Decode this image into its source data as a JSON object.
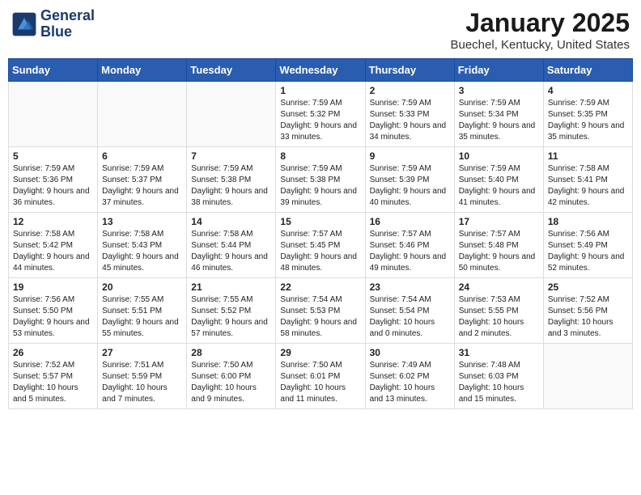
{
  "logo": {
    "line1": "General",
    "line2": "Blue"
  },
  "title": "January 2025",
  "location": "Buechel, Kentucky, United States",
  "days_of_week": [
    "Sunday",
    "Monday",
    "Tuesday",
    "Wednesday",
    "Thursday",
    "Friday",
    "Saturday"
  ],
  "weeks": [
    [
      {
        "day": "",
        "sunrise": "",
        "sunset": "",
        "daylight": ""
      },
      {
        "day": "",
        "sunrise": "",
        "sunset": "",
        "daylight": ""
      },
      {
        "day": "",
        "sunrise": "",
        "sunset": "",
        "daylight": ""
      },
      {
        "day": "1",
        "sunrise": "Sunrise: 7:59 AM",
        "sunset": "Sunset: 5:32 PM",
        "daylight": "Daylight: 9 hours and 33 minutes."
      },
      {
        "day": "2",
        "sunrise": "Sunrise: 7:59 AM",
        "sunset": "Sunset: 5:33 PM",
        "daylight": "Daylight: 9 hours and 34 minutes."
      },
      {
        "day": "3",
        "sunrise": "Sunrise: 7:59 AM",
        "sunset": "Sunset: 5:34 PM",
        "daylight": "Daylight: 9 hours and 35 minutes."
      },
      {
        "day": "4",
        "sunrise": "Sunrise: 7:59 AM",
        "sunset": "Sunset: 5:35 PM",
        "daylight": "Daylight: 9 hours and 35 minutes."
      }
    ],
    [
      {
        "day": "5",
        "sunrise": "Sunrise: 7:59 AM",
        "sunset": "Sunset: 5:36 PM",
        "daylight": "Daylight: 9 hours and 36 minutes."
      },
      {
        "day": "6",
        "sunrise": "Sunrise: 7:59 AM",
        "sunset": "Sunset: 5:37 PM",
        "daylight": "Daylight: 9 hours and 37 minutes."
      },
      {
        "day": "7",
        "sunrise": "Sunrise: 7:59 AM",
        "sunset": "Sunset: 5:38 PM",
        "daylight": "Daylight: 9 hours and 38 minutes."
      },
      {
        "day": "8",
        "sunrise": "Sunrise: 7:59 AM",
        "sunset": "Sunset: 5:38 PM",
        "daylight": "Daylight: 9 hours and 39 minutes."
      },
      {
        "day": "9",
        "sunrise": "Sunrise: 7:59 AM",
        "sunset": "Sunset: 5:39 PM",
        "daylight": "Daylight: 9 hours and 40 minutes."
      },
      {
        "day": "10",
        "sunrise": "Sunrise: 7:59 AM",
        "sunset": "Sunset: 5:40 PM",
        "daylight": "Daylight: 9 hours and 41 minutes."
      },
      {
        "day": "11",
        "sunrise": "Sunrise: 7:58 AM",
        "sunset": "Sunset: 5:41 PM",
        "daylight": "Daylight: 9 hours and 42 minutes."
      }
    ],
    [
      {
        "day": "12",
        "sunrise": "Sunrise: 7:58 AM",
        "sunset": "Sunset: 5:42 PM",
        "daylight": "Daylight: 9 hours and 44 minutes."
      },
      {
        "day": "13",
        "sunrise": "Sunrise: 7:58 AM",
        "sunset": "Sunset: 5:43 PM",
        "daylight": "Daylight: 9 hours and 45 minutes."
      },
      {
        "day": "14",
        "sunrise": "Sunrise: 7:58 AM",
        "sunset": "Sunset: 5:44 PM",
        "daylight": "Daylight: 9 hours and 46 minutes."
      },
      {
        "day": "15",
        "sunrise": "Sunrise: 7:57 AM",
        "sunset": "Sunset: 5:45 PM",
        "daylight": "Daylight: 9 hours and 48 minutes."
      },
      {
        "day": "16",
        "sunrise": "Sunrise: 7:57 AM",
        "sunset": "Sunset: 5:46 PM",
        "daylight": "Daylight: 9 hours and 49 minutes."
      },
      {
        "day": "17",
        "sunrise": "Sunrise: 7:57 AM",
        "sunset": "Sunset: 5:48 PM",
        "daylight": "Daylight: 9 hours and 50 minutes."
      },
      {
        "day": "18",
        "sunrise": "Sunrise: 7:56 AM",
        "sunset": "Sunset: 5:49 PM",
        "daylight": "Daylight: 9 hours and 52 minutes."
      }
    ],
    [
      {
        "day": "19",
        "sunrise": "Sunrise: 7:56 AM",
        "sunset": "Sunset: 5:50 PM",
        "daylight": "Daylight: 9 hours and 53 minutes."
      },
      {
        "day": "20",
        "sunrise": "Sunrise: 7:55 AM",
        "sunset": "Sunset: 5:51 PM",
        "daylight": "Daylight: 9 hours and 55 minutes."
      },
      {
        "day": "21",
        "sunrise": "Sunrise: 7:55 AM",
        "sunset": "Sunset: 5:52 PM",
        "daylight": "Daylight: 9 hours and 57 minutes."
      },
      {
        "day": "22",
        "sunrise": "Sunrise: 7:54 AM",
        "sunset": "Sunset: 5:53 PM",
        "daylight": "Daylight: 9 hours and 58 minutes."
      },
      {
        "day": "23",
        "sunrise": "Sunrise: 7:54 AM",
        "sunset": "Sunset: 5:54 PM",
        "daylight": "Daylight: 10 hours and 0 minutes."
      },
      {
        "day": "24",
        "sunrise": "Sunrise: 7:53 AM",
        "sunset": "Sunset: 5:55 PM",
        "daylight": "Daylight: 10 hours and 2 minutes."
      },
      {
        "day": "25",
        "sunrise": "Sunrise: 7:52 AM",
        "sunset": "Sunset: 5:56 PM",
        "daylight": "Daylight: 10 hours and 3 minutes."
      }
    ],
    [
      {
        "day": "26",
        "sunrise": "Sunrise: 7:52 AM",
        "sunset": "Sunset: 5:57 PM",
        "daylight": "Daylight: 10 hours and 5 minutes."
      },
      {
        "day": "27",
        "sunrise": "Sunrise: 7:51 AM",
        "sunset": "Sunset: 5:59 PM",
        "daylight": "Daylight: 10 hours and 7 minutes."
      },
      {
        "day": "28",
        "sunrise": "Sunrise: 7:50 AM",
        "sunset": "Sunset: 6:00 PM",
        "daylight": "Daylight: 10 hours and 9 minutes."
      },
      {
        "day": "29",
        "sunrise": "Sunrise: 7:50 AM",
        "sunset": "Sunset: 6:01 PM",
        "daylight": "Daylight: 10 hours and 11 minutes."
      },
      {
        "day": "30",
        "sunrise": "Sunrise: 7:49 AM",
        "sunset": "Sunset: 6:02 PM",
        "daylight": "Daylight: 10 hours and 13 minutes."
      },
      {
        "day": "31",
        "sunrise": "Sunrise: 7:48 AM",
        "sunset": "Sunset: 6:03 PM",
        "daylight": "Daylight: 10 hours and 15 minutes."
      },
      {
        "day": "",
        "sunrise": "",
        "sunset": "",
        "daylight": ""
      }
    ]
  ]
}
